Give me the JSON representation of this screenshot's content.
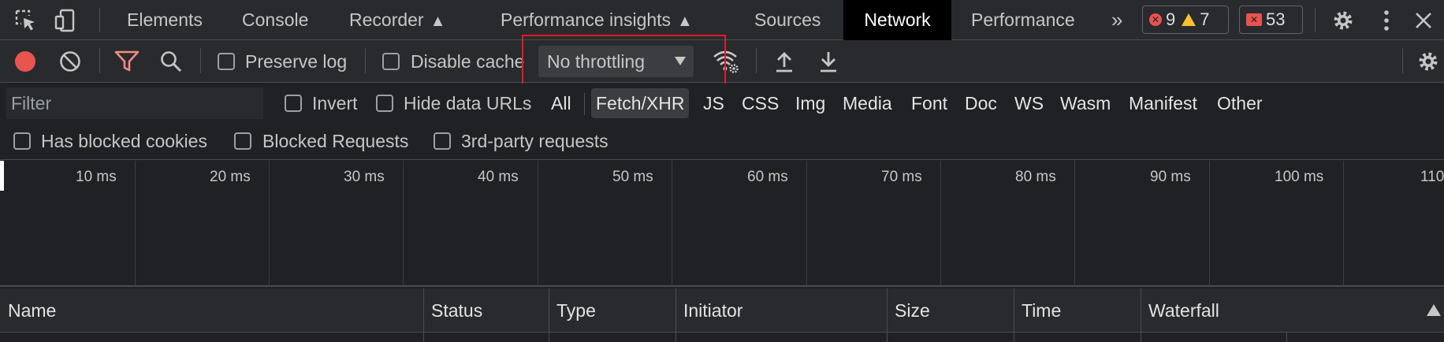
{
  "tabs": {
    "items": [
      "Elements",
      "Console",
      "Recorder",
      "Performance insights",
      "Sources",
      "Network",
      "Performance"
    ],
    "active": "Network",
    "overflow_glyph": "»"
  },
  "badges": {
    "errors": "9",
    "warnings": "7",
    "issues": "53"
  },
  "toolbar": {
    "preserve_log_label": "Preserve log",
    "disable_cache_label": "Disable cache",
    "throttling_value": "No throttling"
  },
  "filter": {
    "placeholder": "Filter",
    "invert_label": "Invert",
    "hide_data_urls_label": "Hide data URLs",
    "types": [
      "All",
      "Fetch/XHR",
      "JS",
      "CSS",
      "Img",
      "Media",
      "Font",
      "Doc",
      "WS",
      "Wasm",
      "Manifest",
      "Other"
    ],
    "active_type": "Fetch/XHR"
  },
  "blocked": {
    "has_blocked_cookies_label": "Has blocked cookies",
    "blocked_requests_label": "Blocked Requests",
    "third_party_label": "3rd-party requests"
  },
  "overview": {
    "ticks": [
      "10 ms",
      "20 ms",
      "30 ms",
      "40 ms",
      "50 ms",
      "60 ms",
      "70 ms",
      "80 ms",
      "90 ms",
      "100 ms",
      "110"
    ]
  },
  "table": {
    "columns": [
      "Name",
      "Status",
      "Type",
      "Initiator",
      "Size",
      "Time",
      "Waterfall"
    ]
  },
  "colors": {
    "record": "#e8544f",
    "filter_active": "#f28b82",
    "highlight": "#e8182a"
  }
}
